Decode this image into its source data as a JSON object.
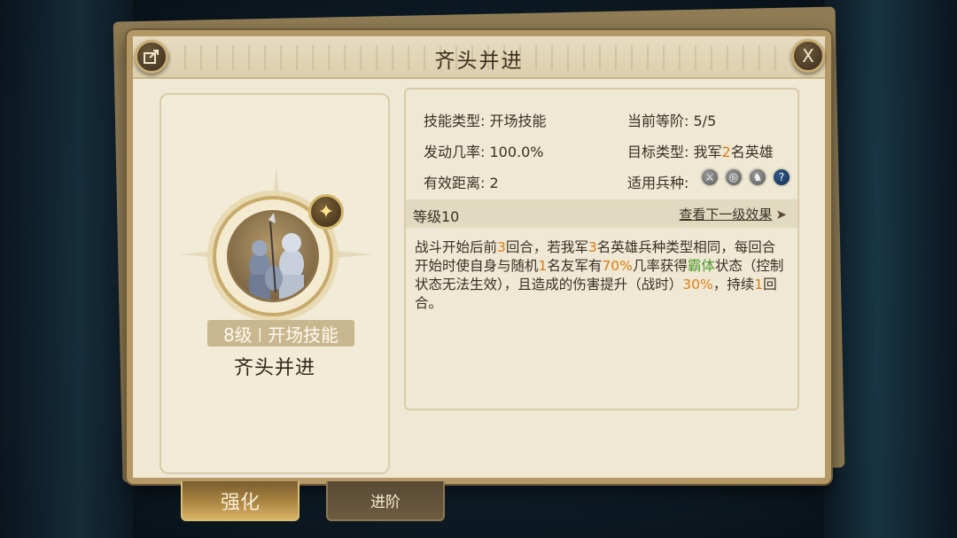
{
  "panel": {
    "title": "齐头并进",
    "share_icon": "share-icon",
    "close_icon": "close-icon",
    "close_glyph": "X"
  },
  "skill": {
    "level_tag": "8级",
    "type_tag": "开场技能",
    "name": "齐头并进"
  },
  "info": {
    "skill_type_label": "技能类型:",
    "skill_type_value": "开场技能",
    "current_rank_label": "当前等阶:",
    "current_rank_value": "5/5",
    "trigger_rate_label": "发动几率:",
    "trigger_rate_value": "100.0%",
    "target_type_label": "目标类型:",
    "target_type_prefix": "我军",
    "target_type_number": "2",
    "target_type_suffix": "名英雄",
    "range_label": "有效距离:",
    "range_value": "2",
    "troop_label": "适用兵种:",
    "troop_icons": [
      "sword-icon",
      "bow-icon",
      "cavalry-icon",
      "unknown-icon"
    ]
  },
  "level_bar": {
    "label": "等级10",
    "next_link": "查看下一级效果",
    "arrow": "➤"
  },
  "description": {
    "p1": "战斗开始后前",
    "n1": "3",
    "p2": "回合，若我军",
    "n2": "3",
    "p3": "名英雄兵种类型相同，每回合开始时使自身与随机",
    "n3": "1",
    "p4": "名友军有",
    "n4": "70%",
    "p5": "几率获得",
    "g1": "霸体",
    "p6": "状态（控制状态无法生效），且造成的伤害提升（战时）",
    "n5": "30%",
    "p7": "，持续",
    "n6": "1",
    "p8": "回合。"
  },
  "tabs": {
    "strengthen": "强化",
    "advance": "进阶"
  },
  "colors": {
    "highlight_orange": "#e07b12",
    "highlight_green": "#4c9a2a",
    "panel_bg": "#efe8d4"
  }
}
